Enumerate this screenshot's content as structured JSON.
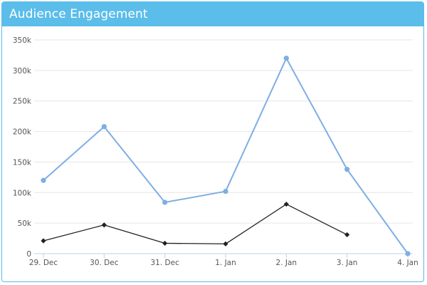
{
  "panel": {
    "title": "Audience Engagement"
  },
  "chart_data": {
    "type": "line",
    "categories": [
      "29. Dec",
      "30. Dec",
      "31. Dec",
      "1. Jan",
      "2. Jan",
      "3. Jan",
      "4. Jan"
    ],
    "y_ticks": [
      "0",
      "50k",
      "100k",
      "150k",
      "200k",
      "250k",
      "300k",
      "350k"
    ],
    "ylim": [
      0,
      350000
    ],
    "grid": true,
    "legend": "none",
    "series": [
      {
        "color": "#7eaee3",
        "marker": "circle",
        "values": [
          120000,
          208000,
          84000,
          102000,
          320000,
          138000,
          0
        ]
      },
      {
        "color": "#222222",
        "marker": "diamond",
        "values": [
          21000,
          47000,
          17000,
          16000,
          81000,
          31000,
          null
        ]
      }
    ]
  }
}
